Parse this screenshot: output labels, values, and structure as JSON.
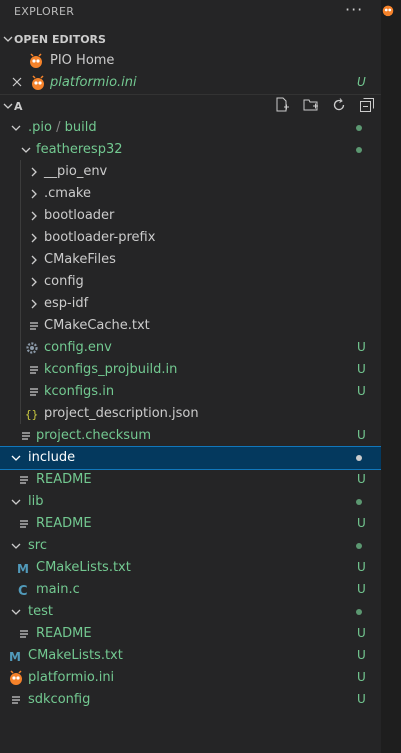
{
  "header": {
    "title": "EXPLORER",
    "more": "···"
  },
  "open_editors": {
    "title": "OPEN EDITORS",
    "items": [
      {
        "label": "PIO Home",
        "badge": ""
      },
      {
        "label": "platformio.ini",
        "badge": "U"
      }
    ]
  },
  "workspace": {
    "title": "A"
  },
  "tree": [
    {
      "label": ".pio",
      "sub": "build",
      "badge": "",
      "dot": true
    },
    {
      "label": "featheresp32",
      "badge": "",
      "dot": true
    },
    {
      "label": "__pio_env"
    },
    {
      "label": ".cmake"
    },
    {
      "label": "bootloader"
    },
    {
      "label": "bootloader-prefix"
    },
    {
      "label": "CMakeFiles"
    },
    {
      "label": "config"
    },
    {
      "label": "esp-idf"
    },
    {
      "label": "CMakeCache.txt"
    },
    {
      "label": "config.env",
      "badge": "U"
    },
    {
      "label": "kconfigs_projbuild.in",
      "badge": "U"
    },
    {
      "label": "kconfigs.in",
      "badge": "U"
    },
    {
      "label": "project_description.json"
    },
    {
      "label": "project.checksum",
      "badge": "U"
    },
    {
      "label": "include"
    },
    {
      "label": "README",
      "badge": "U"
    },
    {
      "label": "lib"
    },
    {
      "label": "README",
      "badge": "U"
    },
    {
      "label": "src"
    },
    {
      "label": "CMakeLists.txt",
      "badge": "U"
    },
    {
      "label": "main.c",
      "badge": "U"
    },
    {
      "label": "test"
    },
    {
      "label": "README",
      "badge": "U"
    },
    {
      "label": "CMakeLists.txt",
      "badge": "U"
    },
    {
      "label": "platformio.ini",
      "badge": "U"
    },
    {
      "label": "sdkconfig",
      "badge": "U"
    }
  ],
  "colors": {
    "untracked": "#73c991",
    "selection": "#04395e",
    "selection_border": "#1177bb"
  }
}
